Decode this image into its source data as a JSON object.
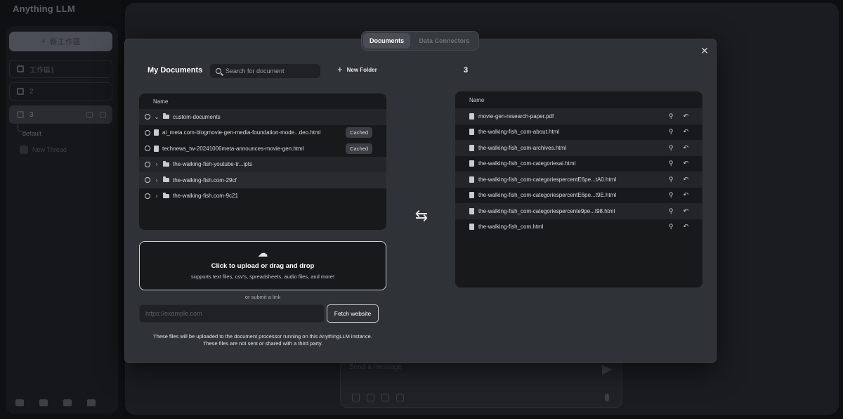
{
  "app": {
    "brand": "Anything LLM",
    "new_workspace": "新工作區",
    "workspaces": [
      {
        "label": "工作區1"
      },
      {
        "label": "2"
      },
      {
        "label": "3"
      }
    ],
    "threads": {
      "default": "default",
      "new_thread": "New Thread"
    },
    "chat": {
      "placeholder": "Send a message"
    }
  },
  "modal": {
    "tabs": [
      {
        "label": "Documents",
        "active": true
      },
      {
        "label": "Data Connectors",
        "active": false
      }
    ],
    "my_documents": {
      "title": "My Documents",
      "search_placeholder": "Search for document",
      "new_folder": "New Folder",
      "column_name": "Name",
      "items": [
        {
          "type": "folder",
          "name": "custom-documents",
          "expanded": true
        },
        {
          "type": "file",
          "name": "ai_meta.com-blogmovie-gen-media-foundation-mode...deo.html",
          "badge": "Cached"
        },
        {
          "type": "file",
          "name": "technews_tw-20241006meta-announces-movie-gen.html",
          "badge": "Cached"
        },
        {
          "type": "folder",
          "name": "the-walking-fish-youtube-tr...ipts",
          "expanded": false
        },
        {
          "type": "folder",
          "name": "the-walking-fish.com-29cf",
          "expanded": false
        },
        {
          "type": "folder",
          "name": "the-walking-fish.com-9c21",
          "expanded": false
        }
      ]
    },
    "workspace": {
      "title": "3",
      "column_name": "Name",
      "files": [
        {
          "name": "movie-gen-research-paper.pdf"
        },
        {
          "name": "the-walking-fish_com-about.html"
        },
        {
          "name": "the-walking-fish_com-archives.html"
        },
        {
          "name": "the-walking-fish_com-categoriesai.html"
        },
        {
          "name": "the-walking-fish_com-categoriespercentE6pe...tA0.html"
        },
        {
          "name": "the-walking-fish_com-categoriespercentE6pe...t9E.html"
        },
        {
          "name": "the-walking-fish_com-categoriespercente9pe...t98.html"
        },
        {
          "name": "the-walking-fish_com.html"
        }
      ]
    },
    "upload": {
      "title": "Click to upload or drag and drop",
      "subtitle": "supports text files, csv's, spreadsheets, audio files, and more!",
      "or_link": "or submit a link",
      "url_placeholder": "https://example.com",
      "fetch_label": "Fetch website",
      "disclaimer_1": "These files will be uploaded to the document processor running on this AnythingLLM instance.",
      "disclaimer_2": "These files are not sent or shared with a third party."
    }
  }
}
